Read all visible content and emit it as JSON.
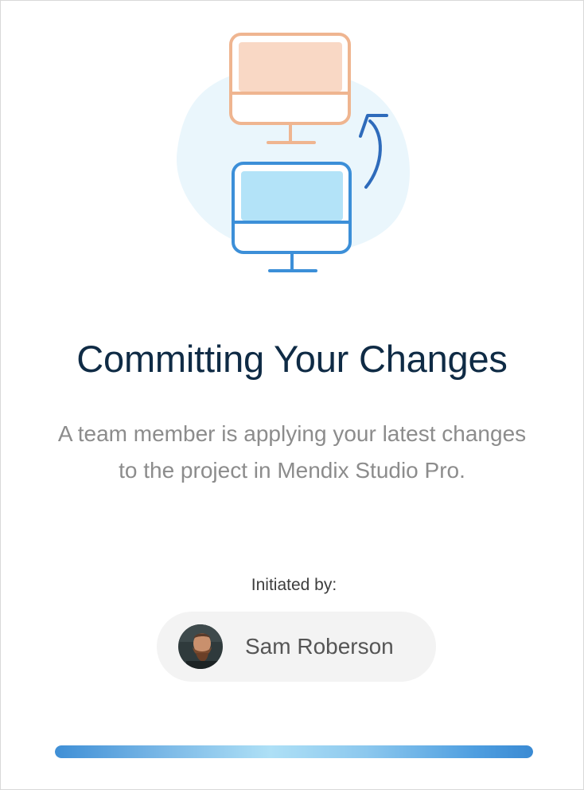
{
  "dialog": {
    "title": "Committing Your Changes",
    "description_line1": "A team member is applying your latest changes",
    "description_line2": "to the project in Mendix Studio Pro.",
    "initiated_label": "Initiated by:",
    "user": {
      "name": "Sam Roberson",
      "avatar_icon": "user-avatar-photo"
    },
    "progress": {
      "fill_fraction": 1.0,
      "colors": [
        "#3f8fd6",
        "#aee0f6",
        "#3a8ad3"
      ]
    },
    "illustration": {
      "icon": "sync-monitors-illustration",
      "colors": {
        "blob": "#eaf6fc",
        "top_monitor_outline": "#efb590",
        "top_monitor_screen": "#f9d8c5",
        "bottom_monitor_outline": "#3c8fd8",
        "bottom_monitor_screen": "#b3e3f8",
        "arrow": "#2e6bbb"
      }
    },
    "colors": {
      "title": "#0f2b45",
      "description": "#8c8c8c",
      "chip_background": "#f3f3f3"
    }
  }
}
